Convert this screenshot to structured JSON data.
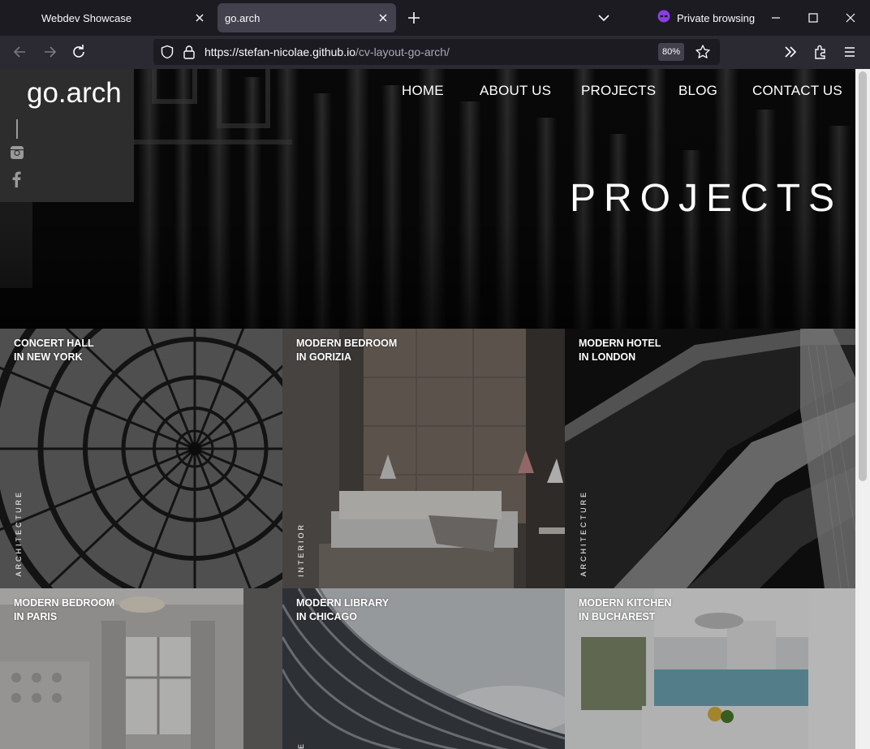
{
  "browser": {
    "tabs": [
      {
        "title": "Webdev Showcase",
        "active": false
      },
      {
        "title": "go.arch",
        "active": true
      }
    ],
    "private_label": "Private browsing",
    "url_host": "https://stefan-nicolae.github.io",
    "url_path": "/cv-layout-go-arch/",
    "zoom": "80%"
  },
  "site": {
    "logo": "go.arch",
    "nav": [
      "HOME",
      "ABOUT US",
      "PROJECTS",
      "BLOG",
      "CONTACT US"
    ],
    "hero_title": "PROJECTS",
    "social": [
      "instagram-icon",
      "facebook-icon"
    ]
  },
  "projects": [
    {
      "line1": "CONCERT HALL",
      "line2": "IN NEW YORK",
      "category": "ARCHITECTURE"
    },
    {
      "line1": "MODERN BEDROOM",
      "line2": "IN GORIZIA",
      "category": "INTERIOR"
    },
    {
      "line1": "MODERN HOTEL",
      "line2": "IN LONDON",
      "category": "ARCHITECTURE"
    },
    {
      "line1": "MODERN BEDROOM",
      "line2": "IN PARIS",
      "category": ""
    },
    {
      "line1": "MODERN LIBRARY",
      "line2": "IN CHICAGO",
      "category": "E"
    },
    {
      "line1": "MODERN KITCHEN",
      "line2": "IN BUCHAREST",
      "category": ""
    }
  ],
  "colors": {
    "chrome_bg": "#1c1b22",
    "toolbar_bg": "#2b2a33",
    "active_tab": "#42414d",
    "logo_box": "#2d2d2d",
    "private_accent": "#8c3de6"
  }
}
